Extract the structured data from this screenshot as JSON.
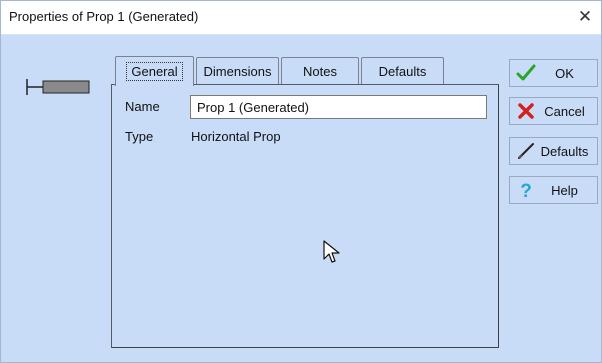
{
  "window": {
    "title": "Properties of Prop 1 (Generated)",
    "close_glyph": "✕"
  },
  "tabs": [
    {
      "label": "General",
      "active": true
    },
    {
      "label": "Dimensions",
      "active": false
    },
    {
      "label": "Notes",
      "active": false
    },
    {
      "label": "Defaults",
      "active": false
    }
  ],
  "general": {
    "name_label": "Name",
    "name_value": "Prop 1 (Generated)",
    "type_label": "Type",
    "type_value": "Horizontal Prop"
  },
  "buttons": {
    "ok": {
      "label": "OK",
      "icon": "check-icon",
      "color": "#2aa52a"
    },
    "cancel": {
      "label": "Cancel",
      "icon": "cross-icon",
      "color": "#d42020"
    },
    "defaults": {
      "label": "Defaults",
      "icon": "pen-icon"
    },
    "help": {
      "label": "Help",
      "icon": "question-icon",
      "color": "#22a8d8"
    }
  },
  "colors": {
    "background": "#c9dcf7"
  }
}
